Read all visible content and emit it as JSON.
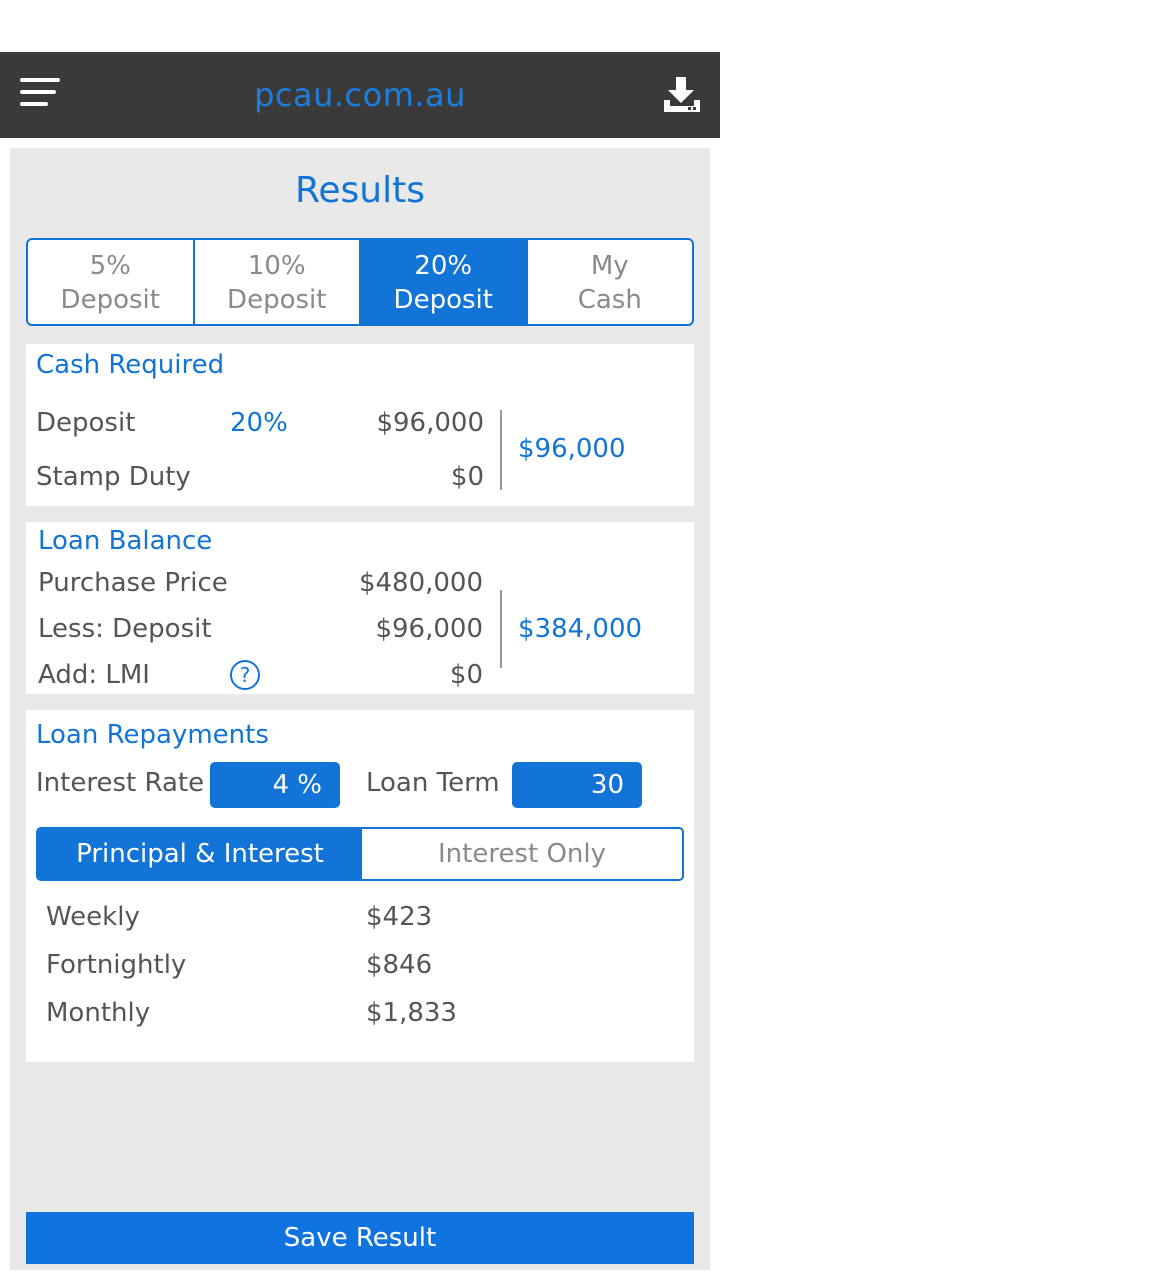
{
  "header": {
    "site_title": "pcau.com.au",
    "menu_icon": "hamburger-menu-icon",
    "download_icon": "download-icon"
  },
  "results": {
    "title": "Results",
    "tabs": [
      {
        "line1": "5%",
        "line2": "Deposit",
        "active": false
      },
      {
        "line1": "10%",
        "line2": "Deposit",
        "active": false
      },
      {
        "line1": "20%",
        "line2": "Deposit",
        "active": true
      },
      {
        "line1": "My",
        "line2": "Cash",
        "active": false
      }
    ]
  },
  "cash_required": {
    "title": "Cash Required",
    "deposit_label": "Deposit",
    "deposit_percent": "20%",
    "deposit_value": "$96,000",
    "stamp_duty_label": "Stamp Duty",
    "stamp_duty_value": "$0",
    "total": "$96,000"
  },
  "loan_balance": {
    "title": "Loan Balance",
    "purchase_price_label": "Purchase Price",
    "purchase_price_value": "$480,000",
    "less_deposit_label": "Less: Deposit",
    "less_deposit_value": "$96,000",
    "lmi_label": "Add: LMI",
    "lmi_help": "?",
    "lmi_value": "$0",
    "total": "$384,000"
  },
  "loan_repayments": {
    "title": "Loan Repayments",
    "interest_rate_label": "Interest Rate",
    "interest_rate_value": "4 %",
    "loan_term_label": "Loan Term",
    "loan_term_value": "30",
    "type_options": [
      "Principal & Interest",
      "Interest Only"
    ],
    "selected_type": "Principal & Interest",
    "rows": [
      {
        "label": "Weekly",
        "value": "$423"
      },
      {
        "label": "Fortnightly",
        "value": "$846"
      },
      {
        "label": "Monthly",
        "value": "$1,833"
      }
    ]
  },
  "actions": {
    "save_label": "Save Result"
  },
  "colors": {
    "accent": "#1174d6",
    "header_bg": "#3a3a3a",
    "panel_bg": "#e9e9e9"
  }
}
